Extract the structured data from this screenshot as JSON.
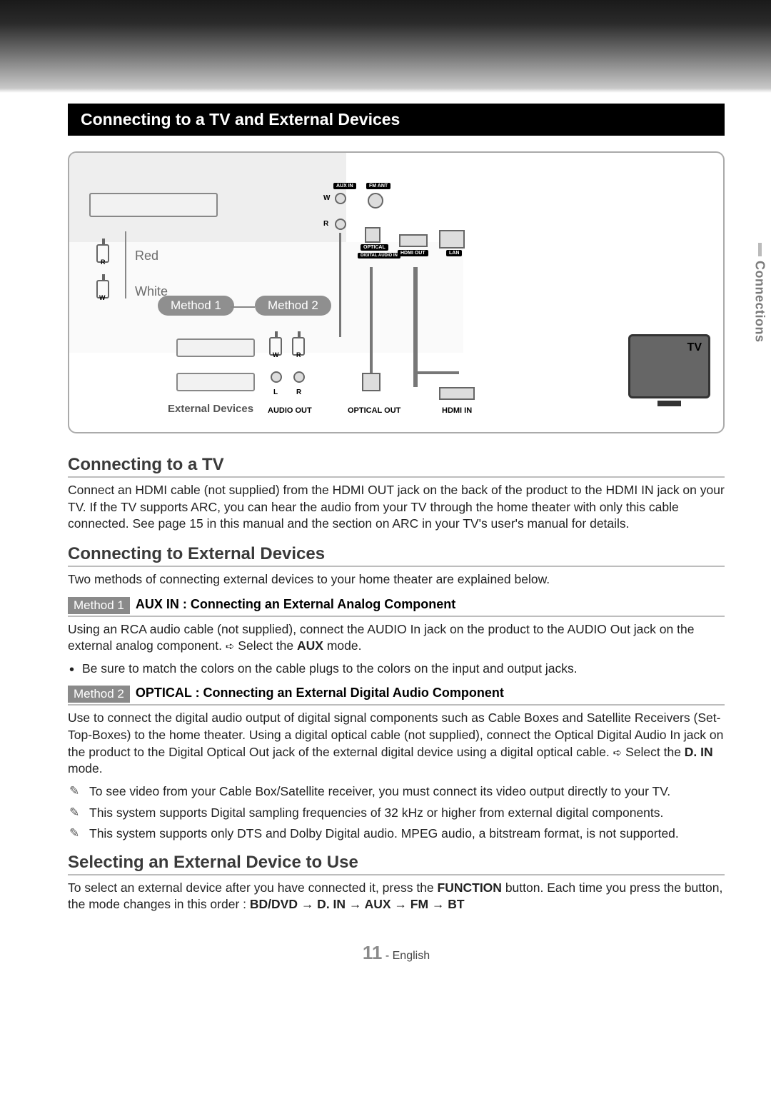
{
  "banner": {
    "title": "Connecting to a TV and External Devices"
  },
  "side_tab": "Connections",
  "diagram": {
    "port_aux": "AUX IN",
    "port_fm": "FM ANT",
    "port_optical": "OPTICAL",
    "port_digital": "DIGITAL AUDIO IN",
    "port_hdmi_out": "HDMI OUT",
    "port_lan": "LAN",
    "color_red": "Red",
    "color_white": "White",
    "red_letter": "R",
    "white_letter": "W",
    "method1": "Method 1",
    "method2": "Method 2",
    "ext_devices": "External Devices",
    "audio_out": "AUDIO OUT",
    "optical_out": "OPTICAL OUT",
    "hdmi_in": "HDMI IN",
    "tv": "TV",
    "aud_L": "L",
    "aud_R": "R",
    "ch_W": "W",
    "ch_R": "R"
  },
  "sec1": {
    "heading": "Connecting to a TV",
    "p": "Connect an HDMI cable (not supplied) from the HDMI OUT jack on the back of the product to the HDMI IN jack on your TV. If the TV supports ARC, you can hear the audio from your TV through the home theater with only this cable connected. See page 15 in this manual and the section on ARC in your TV's user's manual for details."
  },
  "sec2": {
    "heading": "Connecting to External Devices",
    "intro": "Two methods of connecting external devices to your home theater are explained below.",
    "m1_badge": "Method 1",
    "m1_title": "AUX IN : Connecting an External Analog Component",
    "m1_body_a": "Using an RCA audio cable (not supplied), connect the AUDIO In jack on the product to the AUDIO Out jack on the external analog component. ",
    "m1_body_b": " Select the ",
    "m1_body_c": "AUX",
    "m1_body_d": " mode.",
    "m1_bullet": "Be sure to match the colors on the cable plugs to the colors on the input and output jacks.",
    "m2_badge": "Method 2",
    "m2_title": "OPTICAL : Connecting an External Digital Audio Component",
    "m2_body_a": "Use to connect the digital audio output of digital signal components such as Cable Boxes and Satellite Receivers (Set-Top-Boxes) to the home theater. Using a digital optical cable (not supplied), connect the Optical Digital Audio In jack on the product to the Digital Optical Out jack of the external digital device using a digital optical cable. ",
    "m2_body_b": " Select the ",
    "m2_body_c": "D. IN",
    "m2_body_d": " mode.",
    "note1": "To see video from your Cable Box/Satellite receiver, you must connect its video output directly to your TV.",
    "note2": "This system supports Digital sampling frequencies of 32 kHz or higher from external digital components.",
    "note3": "This system supports only DTS and Dolby Digital audio. MPEG audio, a bitstream format, is not supported."
  },
  "sec3": {
    "heading": "Selecting an External Device to Use",
    "p_a": "To select an external device after you have connected it, press the ",
    "p_b": "FUNCTION",
    "p_c": " button. Each time you press the button, the mode changes in this order : ",
    "seq": "BD/DVD → D. IN → AUX → FM → BT"
  },
  "footer": {
    "page": "11",
    "lang": " - English"
  }
}
